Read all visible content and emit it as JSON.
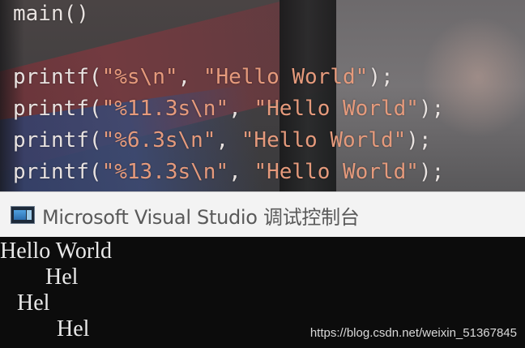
{
  "editor": {
    "lines": [
      {
        "text": "main()",
        "parts": [
          {
            "t": "main()",
            "c": "kw"
          }
        ]
      },
      {
        "text": "",
        "parts": []
      },
      {
        "text": "printf(\"%s\\n\", \"Hello World\");",
        "parts": [
          {
            "t": "printf(",
            "c": "kw"
          },
          {
            "t": "\"%s\\n\"",
            "c": "str"
          },
          {
            "t": ", ",
            "c": "punc"
          },
          {
            "t": "\"Hello World\"",
            "c": "str"
          },
          {
            "t": ");",
            "c": "punc"
          }
        ]
      },
      {
        "text": "printf(\"%11.3s\\n\", \"Hello World\");",
        "parts": [
          {
            "t": "printf(",
            "c": "kw"
          },
          {
            "t": "\"%11.3s\\n\"",
            "c": "str"
          },
          {
            "t": ", ",
            "c": "punc"
          },
          {
            "t": "\"Hello World\"",
            "c": "str"
          },
          {
            "t": ");",
            "c": "punc"
          }
        ]
      },
      {
        "text": "printf(\"%6.3s\\n\", \"Hello World\");",
        "parts": [
          {
            "t": "printf(",
            "c": "kw"
          },
          {
            "t": "\"%6.3s\\n\"",
            "c": "str"
          },
          {
            "t": ", ",
            "c": "punc"
          },
          {
            "t": "\"Hello World\"",
            "c": "str"
          },
          {
            "t": ");",
            "c": "punc"
          }
        ]
      },
      {
        "text": "printf(\"%13.3s\\n\", \"Hello World\");",
        "parts": [
          {
            "t": "printf(",
            "c": "kw"
          },
          {
            "t": "\"%13.3s\\n\"",
            "c": "str"
          },
          {
            "t": ", ",
            "c": "punc"
          },
          {
            "t": "\"Hello World\"",
            "c": "str"
          },
          {
            "t": ");",
            "c": "punc"
          }
        ]
      }
    ],
    "colors": {
      "code": "#e6e0de",
      "string": "#e59a7c"
    }
  },
  "console_window": {
    "title": "Microsoft Visual Studio 调试控制台",
    "icon": "console-app-icon",
    "output_lines": [
      "Hello World",
      "        Hel",
      "   Hel",
      "          Hel"
    ]
  },
  "watermark": "https://blog.csdn.net/weixin_51367845"
}
